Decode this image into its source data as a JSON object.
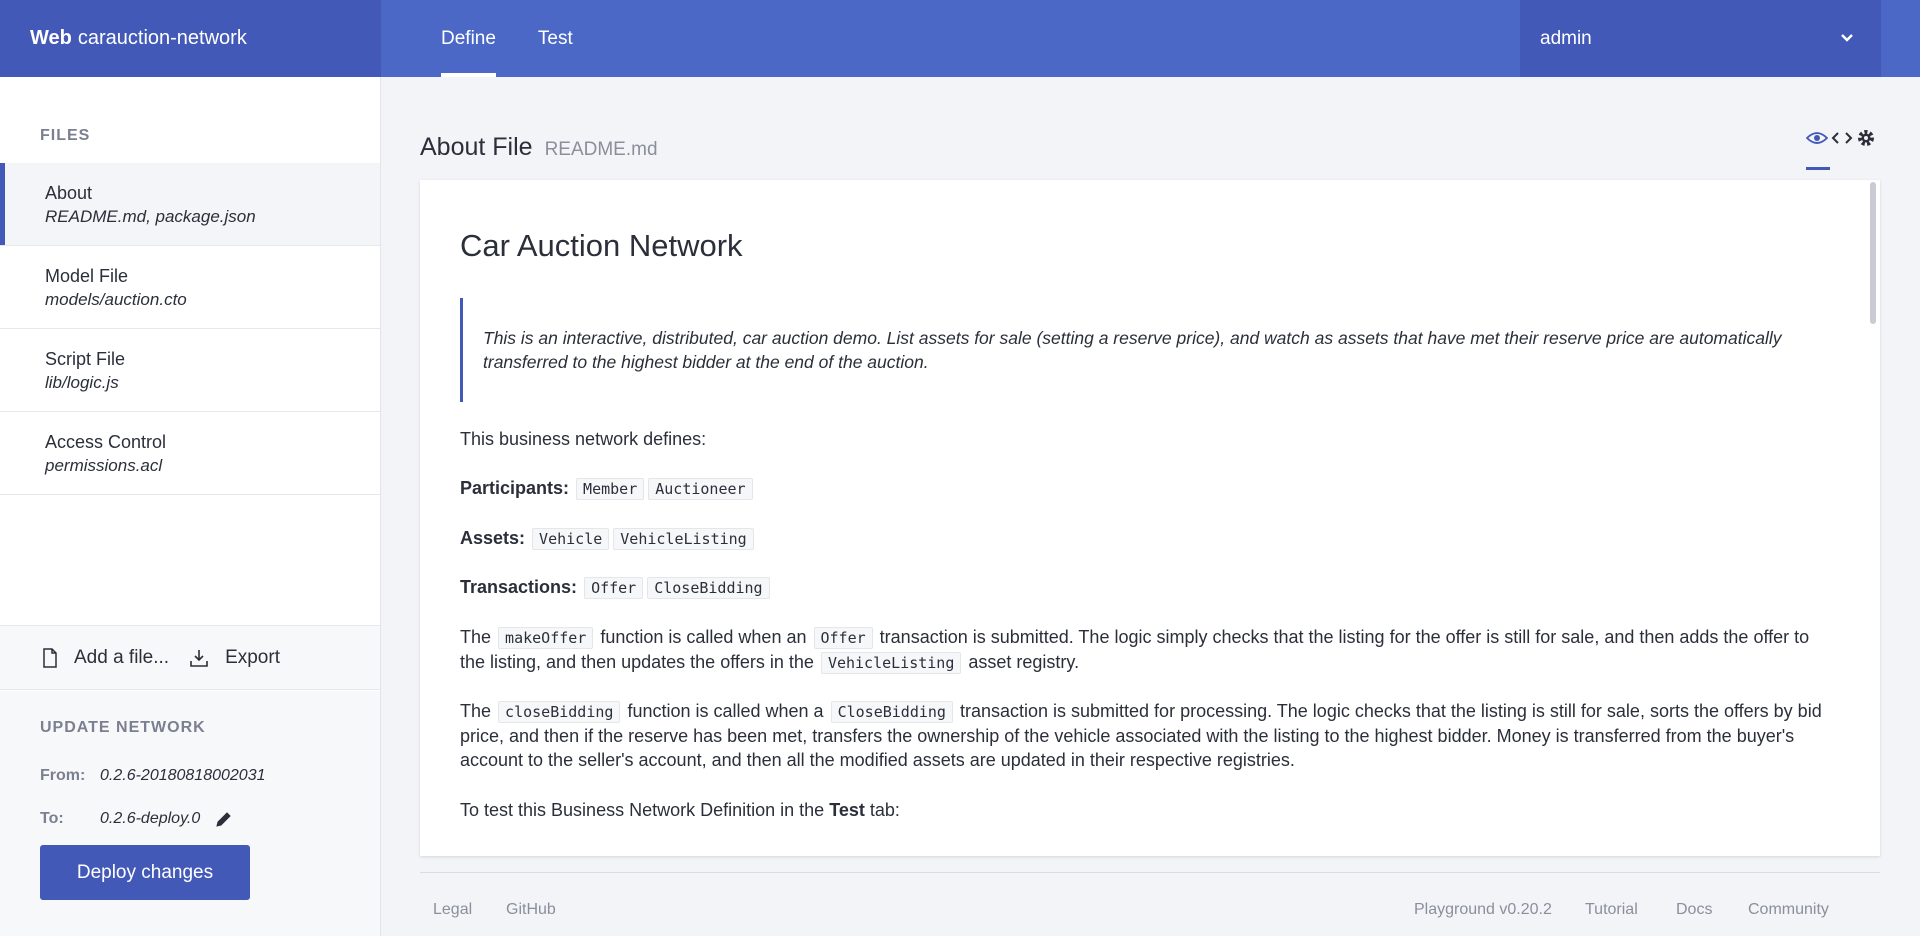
{
  "header": {
    "brand_bold": "Web",
    "brand_name": "carauction-network",
    "tabs": [
      {
        "label": "Define",
        "active": true
      },
      {
        "label": "Test",
        "active": false
      }
    ],
    "user": "admin"
  },
  "sidebar": {
    "files_heading": "FILES",
    "files": [
      {
        "title": "About",
        "sub": "README.md, package.json",
        "active": true
      },
      {
        "title": "Model File",
        "sub": "models/auction.cto"
      },
      {
        "title": "Script File",
        "sub": "lib/logic.js"
      },
      {
        "title": "Access Control",
        "sub": "permissions.acl"
      }
    ],
    "add_file_label": "Add a file...",
    "export_label": "Export",
    "update": {
      "heading": "UPDATE NETWORK",
      "from_label": "From:",
      "from_value": "0.2.6-20180818002031",
      "to_label": "To:",
      "to_value": "0.2.6-deploy.0",
      "deploy_label": "Deploy changes"
    }
  },
  "main": {
    "title": "About File",
    "filename": "README.md",
    "doc": {
      "title": "Car Auction Network",
      "quote": "This is an interactive, distributed, car auction demo. List assets for sale (setting a reserve price), and watch as assets that have met their reserve price are automatically transferred to the highest bidder at the end of the auction.",
      "intro": "This business network defines:",
      "participants_label": "Participants:",
      "participants": [
        "Member",
        "Auctioneer"
      ],
      "assets_label": "Assets:",
      "assets": [
        "Vehicle",
        "VehicleListing"
      ],
      "transactions_label": "Transactions:",
      "transactions": [
        "Offer",
        "CloseBidding"
      ],
      "p1": {
        "t1": "The",
        "c1": "makeOffer",
        "t2": "function is called when an",
        "c2": "Offer",
        "t3": "transaction is submitted. The logic simply checks that the listing for the offer is still for sale, and then adds the offer to the listing, and then updates the offers in the",
        "c3": "VehicleListing",
        "t4": "asset registry."
      },
      "p2": {
        "t1": "The",
        "c1": "closeBidding",
        "t2": "function is called when a",
        "c2": "CloseBidding",
        "t3": "transaction is submitted for processing. The logic checks that the listing is still for sale, sorts the offers by bid price, and then if the reserve has been met, transfers the ownership of the vehicle associated with the listing to the highest bidder. Money is transferred from the buyer's account to the seller's account, and then all the modified assets are updated in their respective registries."
      },
      "p3": {
        "t1": "To test this Business Network Definition in the",
        "b1": "Test",
        "t2": "tab:"
      }
    }
  },
  "footer": {
    "legal": "Legal",
    "github": "GitHub",
    "version": "Playground v0.20.2",
    "tutorial": "Tutorial",
    "docs": "Docs",
    "community": "Community"
  }
}
